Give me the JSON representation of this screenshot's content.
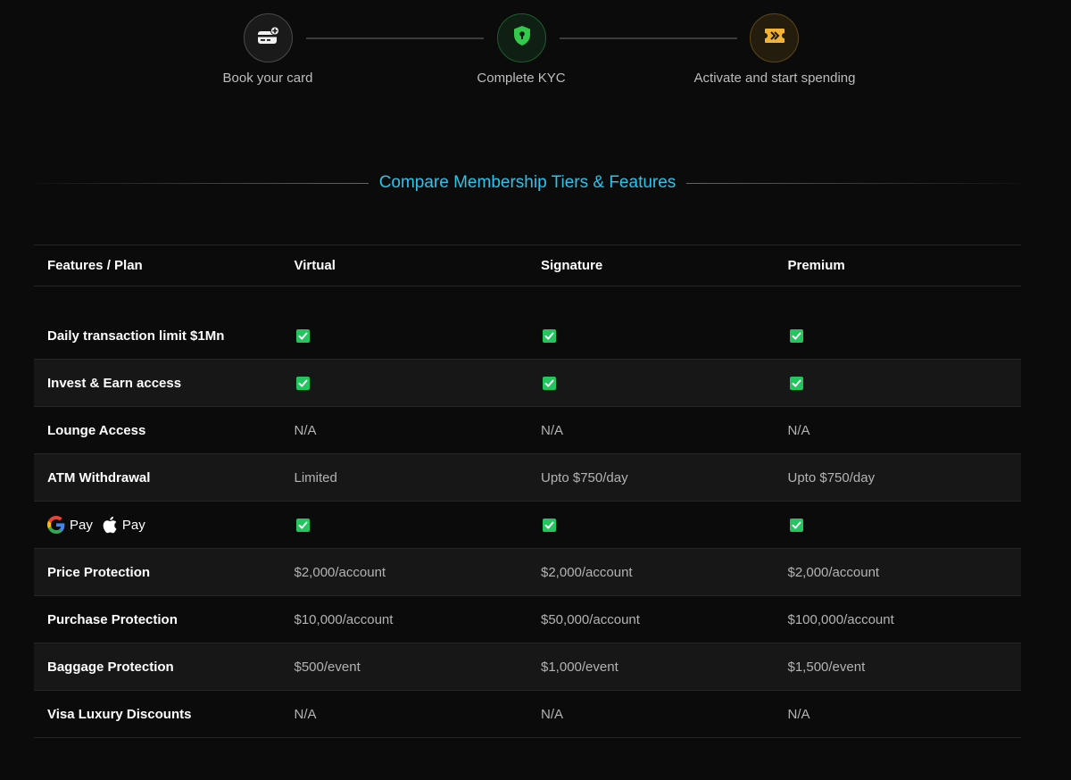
{
  "steps": [
    {
      "label": "Book your card",
      "icon": "card-add-icon"
    },
    {
      "label": "Complete KYC",
      "icon": "shield-lock-icon"
    },
    {
      "label": "Activate and start spending",
      "icon": "activate-ticket-icon"
    }
  ],
  "heading": "Compare Membership Tiers & Features",
  "table": {
    "headers": [
      "Features / Plan",
      "Virtual",
      "Signature",
      "Premium"
    ],
    "pay_labels": {
      "google": "Pay",
      "apple": "Pay"
    },
    "rows": [
      {
        "feature": "Daily transaction limit $1Mn",
        "virtual": "check",
        "signature": "check",
        "premium": "check"
      },
      {
        "feature": "Invest & Earn access",
        "virtual": "check",
        "signature": "check",
        "premium": "check"
      },
      {
        "feature": "Lounge Access",
        "virtual": "N/A",
        "signature": "N/A",
        "premium": "N/A"
      },
      {
        "feature": "ATM Withdrawal",
        "virtual": "Limited",
        "signature": "Upto $750/day",
        "premium": "Upto $750/day"
      },
      {
        "feature": "google-pay-apple-pay",
        "virtual": "check",
        "signature": "check",
        "premium": "check"
      },
      {
        "feature": "Price Protection",
        "virtual": "$2,000/account",
        "signature": "$2,000/account",
        "premium": "$2,000/account"
      },
      {
        "feature": "Purchase Protection",
        "virtual": "$10,000/account",
        "signature": "$50,000/account",
        "premium": "$100,000/account"
      },
      {
        "feature": "Baggage Protection",
        "virtual": "$500/event",
        "signature": "$1,000/event",
        "premium": "$1,500/event"
      },
      {
        "feature": "Visa Luxury Discounts",
        "virtual": "N/A",
        "signature": "N/A",
        "premium": "N/A"
      }
    ]
  },
  "colors": {
    "accent": "#2fc2ea",
    "check": "#22c55e",
    "kyc_shield": "#34c94c",
    "activate_icon": "#f2b233"
  }
}
